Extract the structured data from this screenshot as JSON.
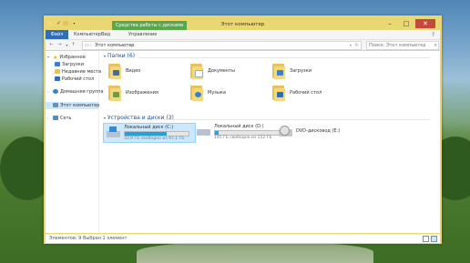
{
  "window": {
    "title": "Этот компьютер",
    "context_tab": "Средства работы с дисками",
    "controls": {
      "minimize": "–",
      "maximize": "□",
      "close": "✕"
    }
  },
  "ribbon": {
    "tabs": [
      "Файл",
      "Компьютер",
      "Вид",
      "Управление"
    ],
    "help": "?"
  },
  "address": {
    "crumbs": [
      "Этот компьютер",
      "›"
    ],
    "search_placeholder": "Поиск: Этот компьютер"
  },
  "sidebar": {
    "favorites": {
      "label": "Избранное",
      "items": [
        "Загрузки",
        "Недавние места",
        "Рабочий стол"
      ]
    },
    "homegroup": "Домашняя группа",
    "this_pc": "Этот компьютер",
    "network": "Сеть"
  },
  "main": {
    "folders_header": "Папки (6)",
    "folders": [
      "Видео",
      "Документы",
      "Загрузки",
      "Изображения",
      "Музыка",
      "Рабочий стол"
    ],
    "devices_header": "Устройства и диски (3)",
    "drives": [
      {
        "name": "Локальный диск (C:)",
        "free": "33,9 ГБ свободно из 97,1 ГБ",
        "used_fraction": 0.65
      },
      {
        "name": "Локальный диск (D:)",
        "free": "145 ГБ свободно из 152 ГБ",
        "used_fraction": 0.05
      },
      {
        "name": "DVD-дисковод (E:)"
      }
    ]
  },
  "status": {
    "count": "Элементов: 9",
    "selected": "Выбран 1 элемент"
  },
  "colors": {
    "accent": "#2f6db8",
    "window_frame": "#e9d774",
    "context_tab": "#59a74c",
    "close_button": "#c7473d",
    "drive_bar": "#26a0da",
    "selection": "#cce8ff"
  }
}
